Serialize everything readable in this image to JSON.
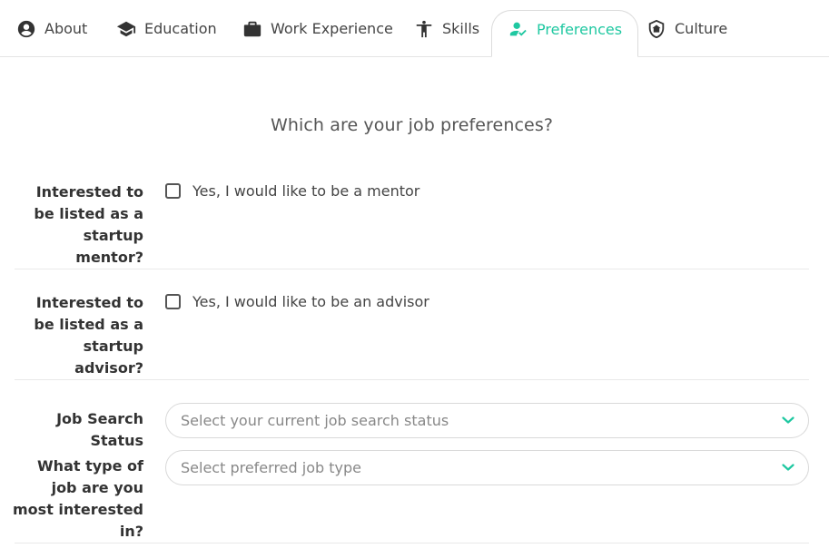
{
  "tabs": [
    {
      "label": "About",
      "icon": "account-circle-icon",
      "active": false
    },
    {
      "label": "Education",
      "icon": "graduation-cap-icon",
      "active": false
    },
    {
      "label": "Work Experience",
      "icon": "briefcase-icon",
      "active": false
    },
    {
      "label": "Skills",
      "icon": "accessibility-person-icon",
      "active": false
    },
    {
      "label": "Preferences",
      "icon": "user-check-icon",
      "active": true
    },
    {
      "label": "Culture",
      "icon": "shield-home-icon",
      "active": false
    }
  ],
  "heading": "Which are your job preferences?",
  "mentor": {
    "label": "Interested to be listed as a startup mentor?",
    "checkbox_label": "Yes, I would like to be a mentor",
    "checked": false
  },
  "advisor": {
    "label": "Interested to be listed as a startup advisor?",
    "checkbox_label": "Yes, I would like to be an advisor",
    "checked": false
  },
  "job_search_status": {
    "label": "Job Search Status",
    "placeholder": "Select your current job search status"
  },
  "job_type": {
    "label": "What type of job are you most interested in?",
    "placeholder": "Select preferred job type"
  },
  "colors": {
    "accent": "#1fc8a1",
    "text": "#333333",
    "placeholder": "#888888",
    "border": "#d9d9d9"
  }
}
